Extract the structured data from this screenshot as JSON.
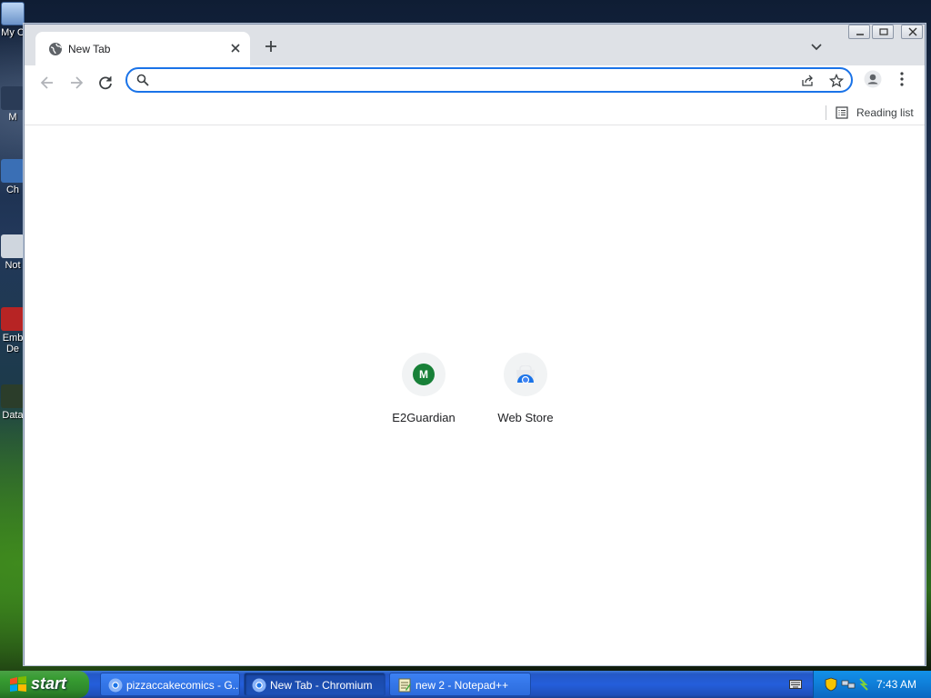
{
  "desktop": {
    "icons": [
      {
        "label": "My C",
        "name": "my-computer"
      },
      {
        "label": "M",
        "name": "desktop-item-2"
      },
      {
        "label": "Ch",
        "name": "desktop-item-3"
      },
      {
        "label": "Not",
        "name": "desktop-item-4"
      },
      {
        "label": "Emb",
        "name": "desktop-item-5a"
      },
      {
        "label": "De",
        "name": "desktop-item-5b"
      },
      {
        "label": "Data",
        "name": "desktop-item-6"
      }
    ]
  },
  "browser": {
    "tab": {
      "title": "New Tab",
      "favicon": "globe-icon"
    },
    "omnibox": {
      "value": "",
      "placeholder": ""
    },
    "reading_list_label": "Reading list",
    "shortcuts": [
      {
        "title": "E2Guardian",
        "badge_letter": "M",
        "badge_color": "#188038"
      },
      {
        "title": "Web Store",
        "icon": "web-store-icon"
      }
    ],
    "accent_color": "#1a73e8"
  },
  "taskbar": {
    "start_label": "start",
    "tasks": [
      {
        "label": "pizzaccakecomics - G...",
        "icon": "chromium-icon",
        "active": false
      },
      {
        "label": "New Tab - Chromium",
        "icon": "chromium-icon",
        "active": true
      },
      {
        "label": "new 2 - Notepad++",
        "icon": "notepad-icon",
        "active": false
      }
    ],
    "clock": "7:43 AM"
  }
}
